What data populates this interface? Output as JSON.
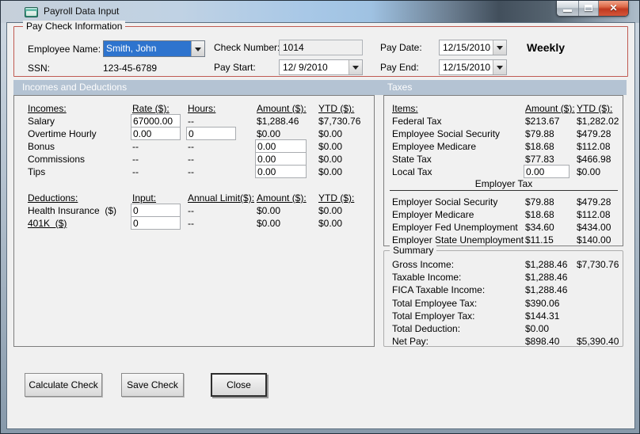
{
  "window": {
    "title": "Payroll Data Input"
  },
  "icons": {
    "close_glyph": "✕"
  },
  "paycheck_info": {
    "group_label": "Pay Check Information",
    "employee_name_label": "Employee Name:",
    "employee_name_value": "Smith, John",
    "ssn_label": "SSN:",
    "ssn_value": "123-45-6789",
    "check_number_label": "Check Number:",
    "check_number_value": "1014",
    "pay_start_label": "Pay Start:",
    "pay_start_value": "12/ 9/2010",
    "pay_date_label": "Pay Date:",
    "pay_date_value": "12/15/2010",
    "pay_end_label": "Pay End:",
    "pay_end_value": "12/15/2010",
    "frequency": "Weekly"
  },
  "sections": {
    "incomes_deductions": "Incomes and Deductions",
    "taxes": "Taxes"
  },
  "incomes": {
    "headers": {
      "item": "Incomes:",
      "rate": "Rate ($):",
      "hours": "Hours:",
      "amount": "Amount ($):",
      "ytd": "YTD ($):"
    },
    "rows": [
      {
        "label": "Salary",
        "rate_input": "67000.00",
        "hours": "--",
        "amount": "$1,288.46",
        "ytd": "$7,730.76"
      },
      {
        "label": "Overtime Hourly",
        "rate_input": "0.00",
        "hours_input": "0",
        "amount": "$0.00",
        "ytd": "$0.00"
      },
      {
        "label": "Bonus",
        "rate": "--",
        "hours": "--",
        "amount_input": "0.00",
        "ytd": "$0.00"
      },
      {
        "label": "Commissions",
        "rate": "--",
        "hours": "--",
        "amount_input": "0.00",
        "ytd": "$0.00"
      },
      {
        "label": "Tips",
        "rate": "--",
        "hours": "--",
        "amount_input": "0.00",
        "ytd": "$0.00"
      }
    ]
  },
  "deductions": {
    "headers": {
      "item": "Deductions:",
      "input": "Input:",
      "limit": "Annual Limit($):",
      "amount": "Amount ($):",
      "ytd": "YTD ($):"
    },
    "rows": [
      {
        "label": "Health Insurance  ($)",
        "input": "0",
        "limit": "--",
        "amount": "$0.00",
        "ytd": "$0.00"
      },
      {
        "label": "401K  ($)",
        "input": "0",
        "limit": "--",
        "amount": "$0.00",
        "ytd": "$0.00"
      }
    ]
  },
  "taxes": {
    "headers": {
      "item": "Items:",
      "amount": "Amount ($):",
      "ytd": "YTD ($):"
    },
    "rows": [
      {
        "label": "Federal Tax",
        "amount": "$213.67",
        "ytd": "$1,282.02"
      },
      {
        "label": "Employee Social Security",
        "amount": "$79.88",
        "ytd": "$479.28"
      },
      {
        "label": "Employee Medicare",
        "amount": "$18.68",
        "ytd": "$112.08"
      },
      {
        "label": "State Tax",
        "amount": "$77.83",
        "ytd": "$466.98"
      },
      {
        "label": "Local Tax",
        "amount_input": "0.00",
        "ytd": "$0.00"
      }
    ],
    "employer_header": "Employer Tax",
    "employer_rows": [
      {
        "label": "Employer Social Security",
        "amount": "$79.88",
        "ytd": "$479.28"
      },
      {
        "label": "Employer Medicare",
        "amount": "$18.68",
        "ytd": "$112.08"
      },
      {
        "label": "Employer Fed Unemployment",
        "amount": "$34.60",
        "ytd": "$434.00"
      },
      {
        "label": "Employer State Unemployment",
        "amount": "$11.15",
        "ytd": "$140.00"
      }
    ]
  },
  "summary": {
    "group_label": "Summary",
    "rows": [
      {
        "label": "Gross Income:",
        "amount": "$1,288.46",
        "ytd": "$7,730.76"
      },
      {
        "label": "Taxable Income:",
        "amount": "$1,288.46",
        "ytd": ""
      },
      {
        "label": "FICA Taxable Income:",
        "amount": "$1,288.46",
        "ytd": ""
      },
      {
        "label": "Total Employee Tax:",
        "amount": "$390.06",
        "ytd": ""
      },
      {
        "label": "Total Employer Tax:",
        "amount": "$144.31",
        "ytd": ""
      },
      {
        "label": "Total Deduction:",
        "amount": "$0.00",
        "ytd": ""
      },
      {
        "label": "Net Pay:",
        "amount": "$898.40",
        "ytd": "$5,390.40"
      }
    ]
  },
  "buttons": {
    "calculate": "Calculate Check",
    "save": "Save Check",
    "close": "Close"
  },
  "colors": {
    "accent_red": "#c05a52",
    "section_band": "#b4c3d3",
    "selection_blue": "#2e74ce",
    "close_button_red": "#c03a20",
    "client_bg": "#f0f0f0"
  }
}
